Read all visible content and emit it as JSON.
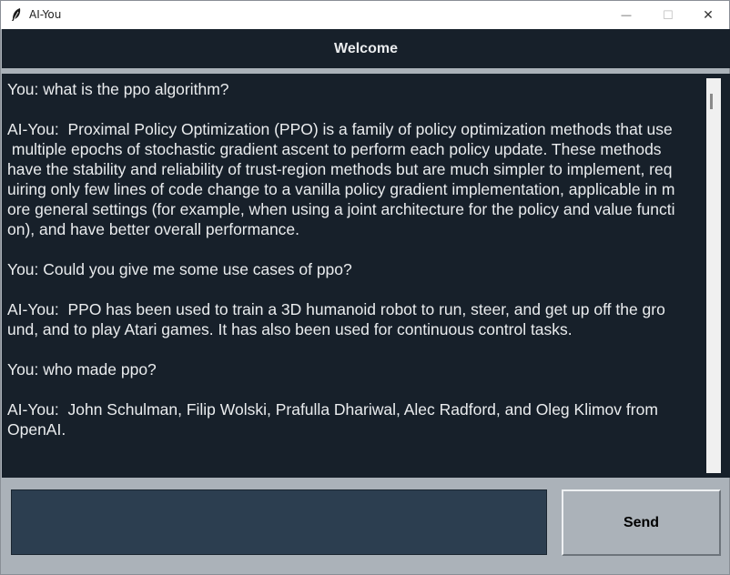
{
  "window": {
    "title": "AI-You",
    "minimize_glyph": "—",
    "maximize_glyph": "☐",
    "close_glyph": "✕"
  },
  "header": {
    "title": "Welcome"
  },
  "chat": {
    "lines": [
      "You: what is the ppo algorithm?",
      "",
      "AI-You:  Proximal Policy Optimization (PPO) is a family of policy optimization methods that use",
      " multiple epochs of stochastic gradient ascent to perform each policy update. These methods",
      "have the stability and reliability of trust-region methods but are much simpler to implement, req",
      "uiring only few lines of code change to a vanilla policy gradient implementation, applicable in m",
      "ore general settings (for example, when using a joint architecture for the policy and value functi",
      "on), and have better overall performance.",
      "",
      "You: Could you give me some use cases of ppo?",
      "",
      "AI-You:  PPO has been used to train a 3D humanoid robot to run, steer, and get up off the gro",
      "und, and to play Atari games. It has also been used for continuous control tasks.",
      "",
      "You: who made ppo?",
      "",
      "AI-You:  John Schulman, Filip Wolski, Prafulla Dhariwal, Alec Radford, and Oleg Klimov from",
      "OpenAI."
    ]
  },
  "input": {
    "value": ""
  },
  "send": {
    "label": "Send"
  },
  "colors": {
    "chat_bg": "#17202a",
    "text": "#eaecee",
    "input_bg": "#2c3e50",
    "window_bg": "#abb2b9"
  },
  "icons": {
    "app": "feather-icon"
  }
}
